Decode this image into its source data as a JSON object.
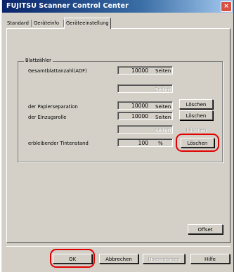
{
  "window": {
    "title": "FUJITSU Scanner Control Center",
    "close_label": "×"
  },
  "tabs": [
    {
      "label": "Standard"
    },
    {
      "label": "Geräteinfo"
    },
    {
      "label": "Geräteeinstellung"
    }
  ],
  "group": {
    "title": "Blattzähler",
    "rows": [
      {
        "label": "Gesamtblattanzahl(ADF)",
        "value": "10000",
        "unit": "Seiten"
      },
      {
        "label": "",
        "value": "",
        "unit": "Seiten",
        "disabled": true
      },
      {
        "label": "der Papierseparation",
        "value": "10000",
        "unit": "Seiten",
        "button": "Löschen"
      },
      {
        "label": "der Einzugsrolle",
        "value": "10000",
        "unit": "Seiten",
        "button": "Löschen"
      },
      {
        "label": "",
        "value": "",
        "unit": "Seiten",
        "disabled": true,
        "button": "Löschen"
      },
      {
        "label": "erbleibender Tintenstand",
        "value": "100",
        "unit": "%",
        "button": "Löschen"
      }
    ]
  },
  "buttons": {
    "offset": "Offset",
    "ok": "OK",
    "cancel": "Abbrechen",
    "apply": "Übernehmen",
    "help": "Hilfe"
  },
  "colors": {
    "highlight": "#e00000",
    "title_bar": "#0a246a"
  }
}
